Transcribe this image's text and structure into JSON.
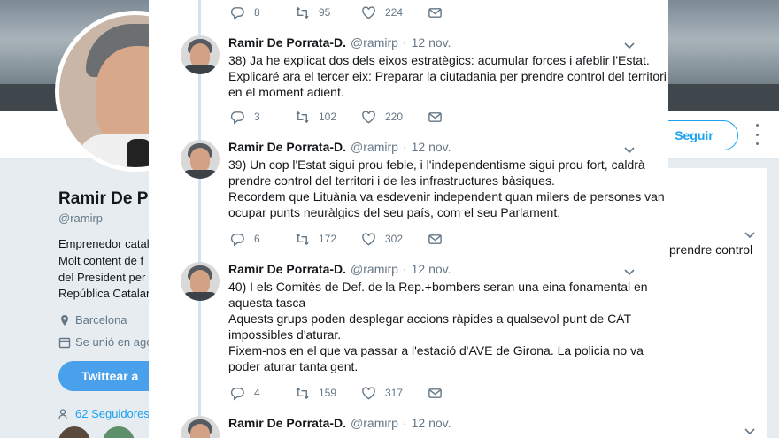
{
  "profile": {
    "name": "Ramir De Po",
    "handle": "@ramirp",
    "bio": [
      "Emprenedor catal",
      "Molt content de f",
      "del President per",
      "República Catalan"
    ],
    "location": "Barcelona",
    "joined": "Se unió en ago",
    "tweet_button": "Twittear a",
    "followers": "62 Seguidores",
    "follow_button": "Seguir"
  },
  "right_panel": {
    "snippet": "prendre control"
  },
  "top_actions": {
    "replies": "8",
    "retweets": "95",
    "likes": "224"
  },
  "tweets": [
    {
      "name": "Ramir De Porrata-D.",
      "handle": "@ramirp",
      "date": "12 nov.",
      "lines": [
        "38) Ja he explicat dos dels eixos estratègics: acumular forces i afeblir l'Estat.",
        "Explicaré ara el tercer eix: Preparar la ciutadania per prendre control del territori",
        "en el moment adient."
      ],
      "replies": "3",
      "retweets": "102",
      "likes": "220"
    },
    {
      "name": "Ramir De Porrata-D.",
      "handle": "@ramirp",
      "date": "12 nov.",
      "lines": [
        "39) Un cop l'Estat sigui prou feble, i l'independentisme sigui prou fort, caldrà",
        "prendre control del territori i de les infrastructures bàsiques.",
        "Recordem que Lituània va esdevenir independent quan milers de persones van",
        "ocupar punts neuràlgics del seu país, com el seu Parlament."
      ],
      "replies": "6",
      "retweets": "172",
      "likes": "302"
    },
    {
      "name": "Ramir De Porrata-D.",
      "handle": "@ramirp",
      "date": "12 nov.",
      "lines": [
        "40) I els Comitès de Def. de la Rep.+bombers seran una eina fonamental en",
        "aquesta tasca",
        "Aquests grups poden desplegar accions ràpides a qualsevol punt de CAT",
        "impossibles d'aturar.",
        "Fixem-nos en el que va passar a l'estació d'AVE de Girona. La policia no va",
        "poder aturar tanta gent."
      ],
      "replies": "4",
      "retweets": "159",
      "likes": "317"
    },
    {
      "name": "Ramir De Porrata-D.",
      "handle": "@ramirp",
      "date": "12 nov.",
      "lines": [],
      "replies": "",
      "retweets": "",
      "likes": ""
    }
  ],
  "colors": {
    "accent": "#1da1f2",
    "text": "#14171a",
    "muted": "#657786",
    "thread_line": "#cfe3f3"
  },
  "icons": [
    "reply-icon",
    "retweet-icon",
    "like-icon",
    "message-icon",
    "chevron-down-icon",
    "location-icon",
    "calendar-icon",
    "followers-icon"
  ]
}
